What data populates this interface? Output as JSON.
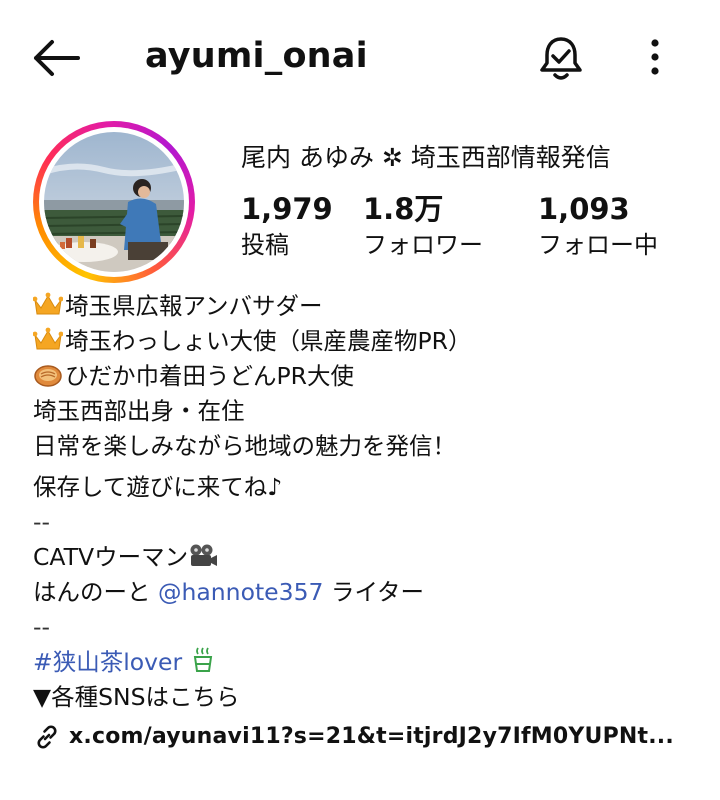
{
  "header": {
    "username": "ayumi_onai",
    "icons": {
      "back": "arrow-left-icon",
      "notifications": "bell-check-icon",
      "more": "more-vertical-icon"
    }
  },
  "profile": {
    "display_name": "尾内 あゆみ ✲ 埼玉西部情報発信",
    "stats": {
      "posts": {
        "value": "1,979",
        "label": "投稿"
      },
      "followers": {
        "value": "1.8万",
        "label": "フォロワー"
      },
      "following": {
        "value": "1,093",
        "label": "フォロー中"
      }
    }
  },
  "bio": {
    "line1": "埼玉県広報アンバサダー",
    "line2": "埼玉わっしょい大使（県産農産物PR）",
    "line3": "ひだか巾着田うどんPR大使",
    "line4": "埼玉西部出身・在住",
    "line5": "日常を楽しみながら地域の魅力を発信！",
    "line6": "保存して遊びに来てね♪",
    "sep1": "--",
    "line7": "CATVウーマン",
    "line8_prefix": "はんのーと ",
    "line8_mention": "@hannote357",
    "line8_suffix": " ライター",
    "sep2": "--",
    "hashtag": "#狭山茶lover",
    "line9": "▼各種SNSはこちら",
    "link": "x.com/ayunavi11?s=21&t=itjrdJ2y7IfM0YUPNt..."
  },
  "colors": {
    "link_blue": "#3b5bb5",
    "text": "#111111",
    "background": "#ffffff"
  }
}
